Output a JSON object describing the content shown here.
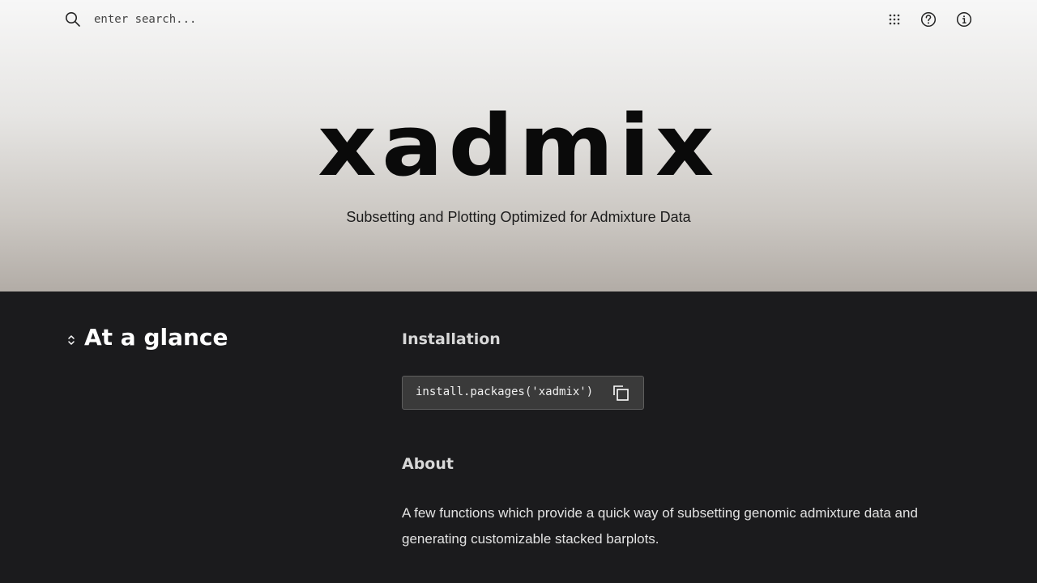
{
  "search": {
    "placeholder": "enter search..."
  },
  "topbar": {
    "icons": [
      "grid-icon",
      "help-icon",
      "info-icon"
    ]
  },
  "hero": {
    "title": "xadmix",
    "subtitle": "Subsetting and Plotting Optimized for Admixture Data"
  },
  "glance": {
    "heading": "At a glance",
    "installation_heading": "Installation",
    "install_code": "install.packages('xadmix')",
    "about_heading": "About",
    "about_text": "A few functions which provide a quick way of subsetting genomic admixture data and generating customizable stacked barplots."
  },
  "colors": {
    "dark_background": "#1b1b1d",
    "code_background": "#3a3a3a",
    "hero_gradient_top": "#f7f7f7",
    "hero_gradient_bottom": "#b2aca6"
  }
}
